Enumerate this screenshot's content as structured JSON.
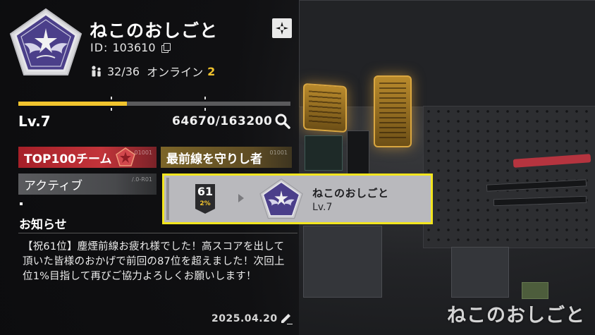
{
  "team": {
    "name": "ねこのおしごと",
    "id_label": "ID:",
    "id_value": "103610",
    "members": "32/36",
    "online_label": "オンライン",
    "online_count": "2"
  },
  "level": {
    "label": "Lv.7",
    "xp": "64670/163200",
    "progress_fraction": 0.4
  },
  "tags": {
    "top100": "TOP100チーム",
    "top100_code": "01001",
    "frontline": "最前線を守りし者",
    "frontline_code": "01001",
    "active": "アクティブ",
    "active_code": "/.0-R01"
  },
  "notice": {
    "title": "お知らせ",
    "body": "【祝61位】塵煙前線お疲れ様でした！高スコアを出して頂いた皆様のおかげで前回の87位を超えました！次回上位1%目指して再びご協力よろしくお願いします！",
    "date": "2025.04.20"
  },
  "popup": {
    "rank": "61",
    "percent": "2%",
    "name": "ねこのおしごと",
    "level": "Lv.7"
  },
  "watermark": "ねこのおしごと",
  "colors": {
    "accent": "#f1c42e",
    "highlight_border": "#f2e51e",
    "emblem_purple": "#4b3f8a",
    "tag_red": "#b7292f",
    "tag_gold": "#7c6528"
  },
  "icons": [
    "team-emblem",
    "copy-icon",
    "members-icon",
    "settings-icon",
    "search-icon",
    "star-icon",
    "edit-icon",
    "rank-badge",
    "chevron-right-icon"
  ]
}
